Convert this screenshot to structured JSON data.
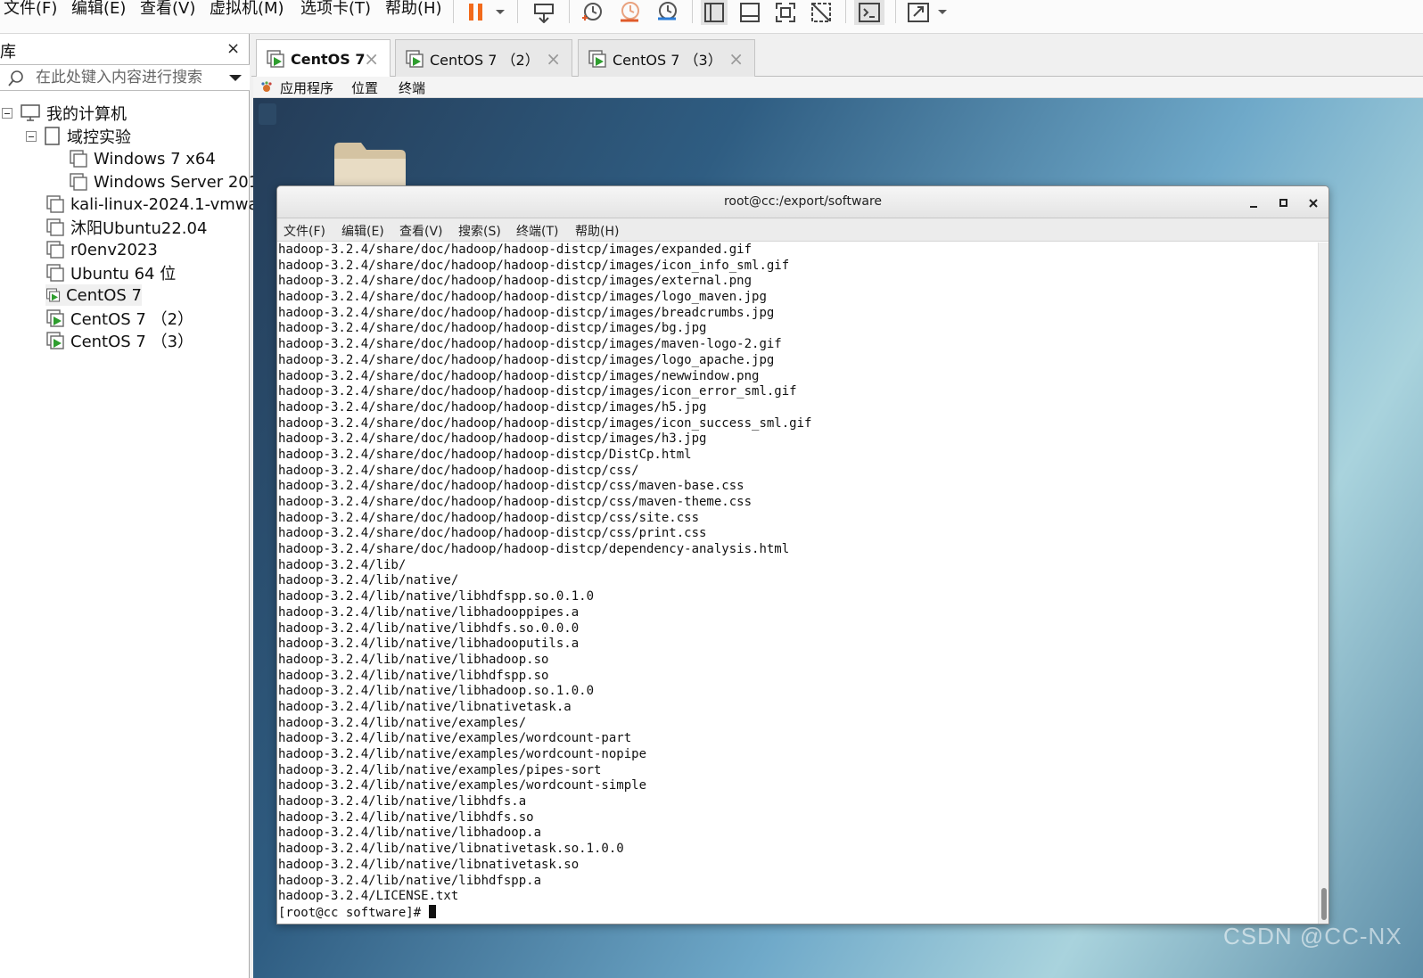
{
  "menubar": {
    "items": [
      "文件(F)",
      "编辑(E)",
      "查看(V)",
      "虚拟机(M)",
      "选项卡(T)",
      "帮助(H)"
    ],
    "toolbar_icons": [
      "pause-icon",
      "dropdown-arrow-icon",
      "send-ctrl-alt-del-icon",
      "snapshot-take-icon",
      "snapshot-revert-icon",
      "snapshot-manager-icon",
      "library-view-icon",
      "thumbnail-bar-icon",
      "fullscreen-icon",
      "unity-icon",
      "console-view-icon",
      "stretch-icon",
      "dropdown-arrow-icon"
    ]
  },
  "library": {
    "title": "库",
    "close": "×",
    "search_placeholder": "在此处键入内容进行搜索",
    "tree": [
      {
        "label": "我的计算机",
        "icon": "computer-icon"
      },
      {
        "label": "域控实验",
        "icon": "folder-icon"
      },
      {
        "label": "Windows 7 x64",
        "icon": "vm-icon"
      },
      {
        "label": "Windows Server 201",
        "icon": "vm-icon"
      },
      {
        "label": "kali-linux-2024.1-vmwa",
        "icon": "vm-icon"
      },
      {
        "label": "沐阳Ubuntu22.04",
        "icon": "vm-icon"
      },
      {
        "label": "r0env2023",
        "icon": "vm-icon"
      },
      {
        "label": "Ubuntu 64 位",
        "icon": "vm-icon"
      },
      {
        "label": "CentOS 7",
        "icon": "vm-running-icon"
      },
      {
        "label": "CentOS 7 （2）",
        "icon": "vm-running-icon"
      },
      {
        "label": "CentOS 7 （3）",
        "icon": "vm-running-icon"
      }
    ]
  },
  "tabs": [
    {
      "label": "CentOS 7",
      "active": true
    },
    {
      "label": "CentOS 7 （2）",
      "active": false
    },
    {
      "label": "CentOS 7 （3）",
      "active": false
    }
  ],
  "gnome": {
    "applications": "应用程序",
    "places": "位置",
    "terminal": "终端"
  },
  "terminal": {
    "title": "root@cc:/export/software",
    "menu": [
      "文件(F)",
      "编辑(E)",
      "查看(V)",
      "搜索(S)",
      "终端(T)",
      "帮助(H)"
    ],
    "lines": [
      "hadoop-3.2.4/share/doc/hadoop/hadoop-distcp/images/expanded.gif",
      "hadoop-3.2.4/share/doc/hadoop/hadoop-distcp/images/icon_info_sml.gif",
      "hadoop-3.2.4/share/doc/hadoop/hadoop-distcp/images/external.png",
      "hadoop-3.2.4/share/doc/hadoop/hadoop-distcp/images/logo_maven.jpg",
      "hadoop-3.2.4/share/doc/hadoop/hadoop-distcp/images/breadcrumbs.jpg",
      "hadoop-3.2.4/share/doc/hadoop/hadoop-distcp/images/bg.jpg",
      "hadoop-3.2.4/share/doc/hadoop/hadoop-distcp/images/maven-logo-2.gif",
      "hadoop-3.2.4/share/doc/hadoop/hadoop-distcp/images/logo_apache.jpg",
      "hadoop-3.2.4/share/doc/hadoop/hadoop-distcp/images/newwindow.png",
      "hadoop-3.2.4/share/doc/hadoop/hadoop-distcp/images/icon_error_sml.gif",
      "hadoop-3.2.4/share/doc/hadoop/hadoop-distcp/images/h5.jpg",
      "hadoop-3.2.4/share/doc/hadoop/hadoop-distcp/images/icon_success_sml.gif",
      "hadoop-3.2.4/share/doc/hadoop/hadoop-distcp/images/h3.jpg",
      "hadoop-3.2.4/share/doc/hadoop/hadoop-distcp/DistCp.html",
      "hadoop-3.2.4/share/doc/hadoop/hadoop-distcp/css/",
      "hadoop-3.2.4/share/doc/hadoop/hadoop-distcp/css/maven-base.css",
      "hadoop-3.2.4/share/doc/hadoop/hadoop-distcp/css/maven-theme.css",
      "hadoop-3.2.4/share/doc/hadoop/hadoop-distcp/css/site.css",
      "hadoop-3.2.4/share/doc/hadoop/hadoop-distcp/css/print.css",
      "hadoop-3.2.4/share/doc/hadoop/hadoop-distcp/dependency-analysis.html",
      "hadoop-3.2.4/lib/",
      "hadoop-3.2.4/lib/native/",
      "hadoop-3.2.4/lib/native/libhdfspp.so.0.1.0",
      "hadoop-3.2.4/lib/native/libhadooppipes.a",
      "hadoop-3.2.4/lib/native/libhdfs.so.0.0.0",
      "hadoop-3.2.4/lib/native/libhadooputils.a",
      "hadoop-3.2.4/lib/native/libhadoop.so",
      "hadoop-3.2.4/lib/native/libhdfspp.so",
      "hadoop-3.2.4/lib/native/libhadoop.so.1.0.0",
      "hadoop-3.2.4/lib/native/libnativetask.a",
      "hadoop-3.2.4/lib/native/examples/",
      "hadoop-3.2.4/lib/native/examples/wordcount-part",
      "hadoop-3.2.4/lib/native/examples/wordcount-nopipe",
      "hadoop-3.2.4/lib/native/examples/pipes-sort",
      "hadoop-3.2.4/lib/native/examples/wordcount-simple",
      "hadoop-3.2.4/lib/native/libhdfs.a",
      "hadoop-3.2.4/lib/native/libhdfs.so",
      "hadoop-3.2.4/lib/native/libhadoop.a",
      "hadoop-3.2.4/lib/native/libnativetask.so.1.0.0",
      "hadoop-3.2.4/lib/native/libnativetask.so",
      "hadoop-3.2.4/lib/native/libhdfspp.a",
      "hadoop-3.2.4/LICENSE.txt"
    ],
    "prompt": "[root@cc software]# "
  },
  "watermark": "CSDN @CC-NX",
  "colors": {
    "pause_accent": "#f26a1b",
    "running_green": "#2f9e2f",
    "desktop_dark": "#243b56",
    "desktop_light": "#a9d3dd"
  }
}
